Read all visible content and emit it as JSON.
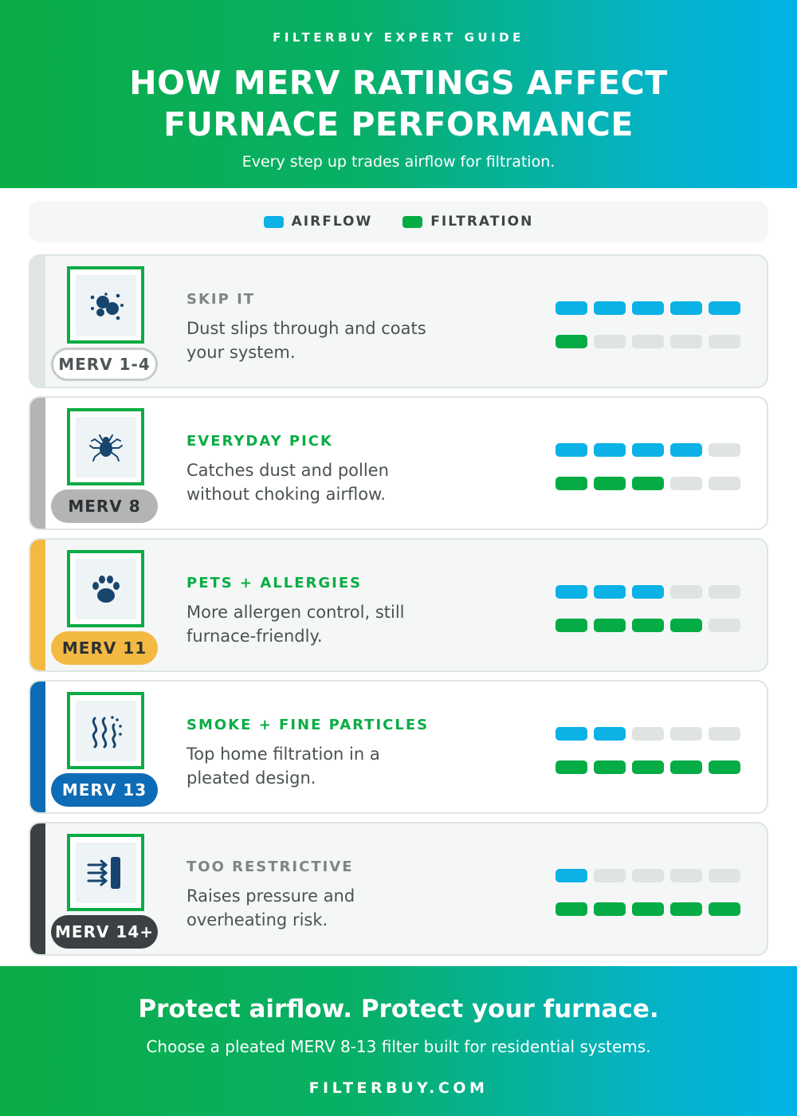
{
  "header": {
    "kicker": "FILTERBUY EXPERT GUIDE",
    "title_line1": "HOW MERV RATINGS AFFECT",
    "title_line2": "FURNACE PERFORMANCE",
    "subtitle": "Every step up trades airflow for filtration."
  },
  "legend": {
    "airflow_label": "AIRFLOW",
    "filtration_label": "FILTRATION"
  },
  "colors": {
    "brand_green": "#0aac45",
    "airflow_blue": "#0cb1e6",
    "filtration_green": "#05ac45",
    "empty_segment": "#dfe3e2"
  },
  "meter_segments": 5,
  "cards": [
    {
      "rating": "MERV 1-4",
      "label": "SKIP IT",
      "description": "Dust slips through and coats your system.",
      "icon": "dust-particles-icon",
      "airflow_level": 5,
      "filtration_level": 1,
      "accent": "#dfe5e3",
      "badge_style": "outline",
      "label_color": "#7d8586"
    },
    {
      "rating": "MERV 8",
      "label": "EVERYDAY PICK",
      "description": "Catches dust and pollen without choking airflow.",
      "icon": "dust-mite-icon",
      "airflow_level": 4,
      "filtration_level": 3,
      "accent": "#b4b4b4",
      "badge_style": "gray",
      "label_color": "#0aac45"
    },
    {
      "rating": "MERV 11",
      "label": "PETS + ALLERGIES",
      "description": "More allergen control, still furnace-friendly.",
      "icon": "paw-print-icon",
      "airflow_level": 3,
      "filtration_level": 4,
      "accent": "#f4b942",
      "badge_style": "yellow",
      "label_color": "#0aac45"
    },
    {
      "rating": "MERV 13",
      "label": "SMOKE + FINE PARTICLES",
      "description": "Top home filtration in a pleated design.",
      "icon": "smoke-wisps-icon",
      "airflow_level": 2,
      "filtration_level": 5,
      "accent": "#0e6bb5",
      "badge_style": "blue",
      "label_color": "#0aac45"
    },
    {
      "rating": "MERV 14+",
      "label": "TOO RESTRICTIVE",
      "description": "Raises pressure and overheating risk.",
      "icon": "blocked-airflow-icon",
      "airflow_level": 1,
      "filtration_level": 5,
      "accent": "#3b4143",
      "badge_style": "dark",
      "label_color": "#7d8586"
    }
  ],
  "footer": {
    "headline": "Protect airflow. Protect your furnace.",
    "subline": "Choose a pleated MERV 8-13 filter built for residential systems.",
    "url": "FILTERBUY.COM"
  }
}
